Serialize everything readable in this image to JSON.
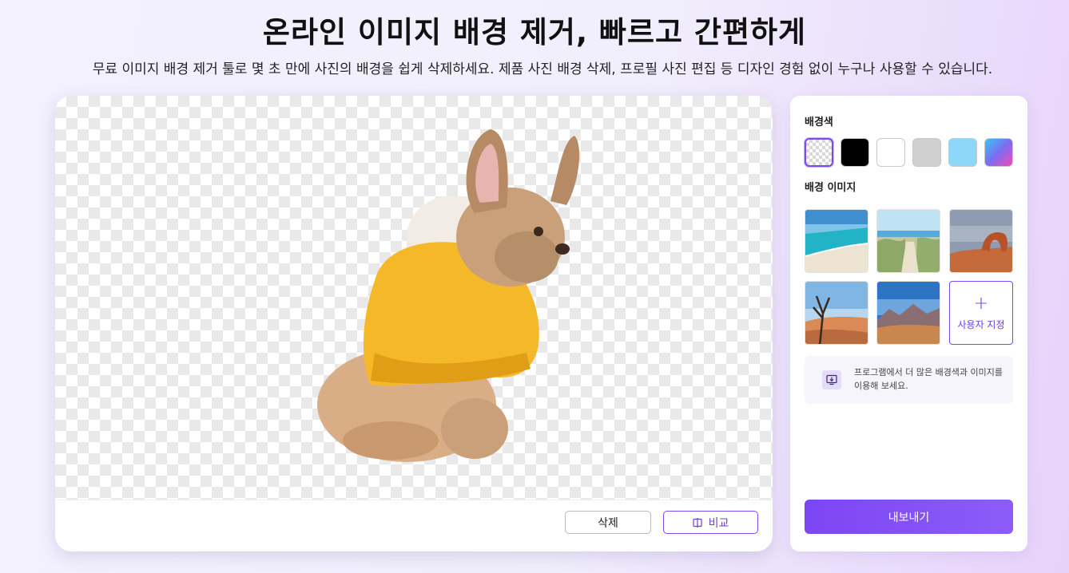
{
  "header": {
    "title": "온라인 이미지 배경 제거, 빠르고 간편하게",
    "subtitle": "무료 이미지 배경 제거 툴로 몇 초 만에 사진의 배경을 쉽게 삭제하세요. 제품 사진 배경 삭제, 프로필 사진 편집 등 디자인 경험 없이 누구나 사용할 수 있습니다."
  },
  "editor": {
    "subject": "french-bulldog-in-yellow-hoodie",
    "delete_label": "삭제",
    "compare_label": "비교"
  },
  "panel": {
    "bg_color_label": "배경색",
    "colors": [
      {
        "name": "transparent",
        "value": "transparent",
        "selected": true
      },
      {
        "name": "black",
        "value": "#000000"
      },
      {
        "name": "white",
        "value": "#ffffff"
      },
      {
        "name": "gray",
        "value": "#cfcfcf"
      },
      {
        "name": "light-blue",
        "value": "#8fd6fb"
      },
      {
        "name": "gradient",
        "value": "linear-gradient(135deg, #39c6f2, #f04bb3)"
      }
    ],
    "bg_image_label": "배경 이미지",
    "images": [
      "beach",
      "dune-path",
      "red-rock-arch",
      "desert-tree",
      "mountain-desert"
    ],
    "custom_label": "사용자 지정",
    "info_text": "프로그램에서 더 많은 배경색과 이미지를 이용해 보세요.",
    "export_label": "내보내기"
  },
  "colors": {
    "accent": "#7a4cf0",
    "export_start": "#7c46f4",
    "export_end": "#8d5cf7"
  }
}
